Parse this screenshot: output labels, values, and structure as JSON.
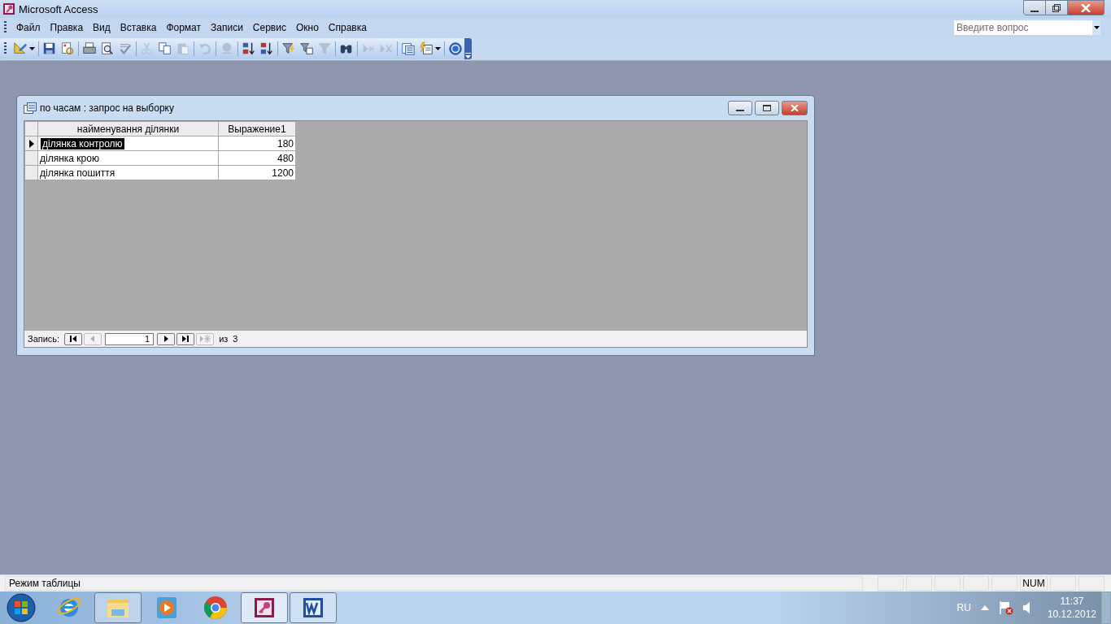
{
  "window": {
    "title": "Microsoft Access"
  },
  "menu": [
    {
      "label": "Файл"
    },
    {
      "label": "Правка"
    },
    {
      "label": "Вид"
    },
    {
      "label": "Вставка"
    },
    {
      "label": "Формат"
    },
    {
      "label": "Записи"
    },
    {
      "label": "Сервис"
    },
    {
      "label": "Окно"
    },
    {
      "label": "Справка"
    }
  ],
  "question_box": {
    "placeholder": "Введите вопрос"
  },
  "toolbar": [
    {
      "kind": "design",
      "disabled": false
    },
    {
      "kind": "sep"
    },
    {
      "kind": "save",
      "disabled": false
    },
    {
      "kind": "search-doc",
      "disabled": false
    },
    {
      "kind": "sep"
    },
    {
      "kind": "print",
      "disabled": false
    },
    {
      "kind": "preview",
      "disabled": false
    },
    {
      "kind": "spelling",
      "disabled": false
    },
    {
      "kind": "sep"
    },
    {
      "kind": "cut",
      "disabled": true
    },
    {
      "kind": "copy",
      "disabled": false
    },
    {
      "kind": "paste",
      "disabled": true
    },
    {
      "kind": "sep"
    },
    {
      "kind": "undo",
      "disabled": true
    },
    {
      "kind": "sep"
    },
    {
      "kind": "link",
      "disabled": true
    },
    {
      "kind": "sep"
    },
    {
      "kind": "sort-asc",
      "disabled": false
    },
    {
      "kind": "sort-desc",
      "disabled": false
    },
    {
      "kind": "sep"
    },
    {
      "kind": "filter-sel",
      "disabled": false
    },
    {
      "kind": "filter-form",
      "disabled": false
    },
    {
      "kind": "filter",
      "disabled": true
    },
    {
      "kind": "sep"
    },
    {
      "kind": "find",
      "disabled": false
    },
    {
      "kind": "sep"
    },
    {
      "kind": "new-record",
      "disabled": true
    },
    {
      "kind": "delete-record",
      "disabled": true
    },
    {
      "kind": "sep"
    },
    {
      "kind": "db-window",
      "disabled": false
    },
    {
      "kind": "new-object",
      "disabled": false
    },
    {
      "kind": "sep"
    },
    {
      "kind": "help",
      "disabled": false
    }
  ],
  "child_window": {
    "title": "по часам : запрос на выборку",
    "table": {
      "columns": [
        "найменування ділянки",
        "Выражение1"
      ],
      "rows": [
        {
          "cells": [
            "ділянка контролю",
            "180"
          ],
          "selected": true
        },
        {
          "cells": [
            "ділянка крою",
            "480"
          ],
          "selected": false
        },
        {
          "cells": [
            "ділянка пошиття",
            "1200"
          ],
          "selected": false
        }
      ]
    },
    "record_nav": {
      "label": "Запись:",
      "current": "1",
      "of": "из",
      "total": "3",
      "buttons": [
        {
          "kind": "first",
          "disabled": false
        },
        {
          "kind": "prev",
          "disabled": true
        },
        {
          "kind": "field"
        },
        {
          "kind": "next",
          "disabled": false
        },
        {
          "kind": "last",
          "disabled": false
        },
        {
          "kind": "new",
          "disabled": true
        }
      ]
    }
  },
  "status_bar": {
    "text": "Режим таблицы",
    "indicators": [
      {
        "label": "NUM",
        "on": true
      }
    ]
  },
  "taskbar": {
    "items": [
      {
        "kind": "ie",
        "open": false,
        "selected": false
      },
      {
        "kind": "explorer",
        "open": true,
        "selected": false
      },
      {
        "kind": "media",
        "open": false,
        "selected": false
      },
      {
        "kind": "chrome",
        "open": false,
        "selected": false
      },
      {
        "kind": "access",
        "open": true,
        "selected": true
      },
      {
        "kind": "word",
        "open": true,
        "selected": false
      }
    ],
    "language": "RU",
    "time": "11:37",
    "date": "10.12.2012"
  }
}
